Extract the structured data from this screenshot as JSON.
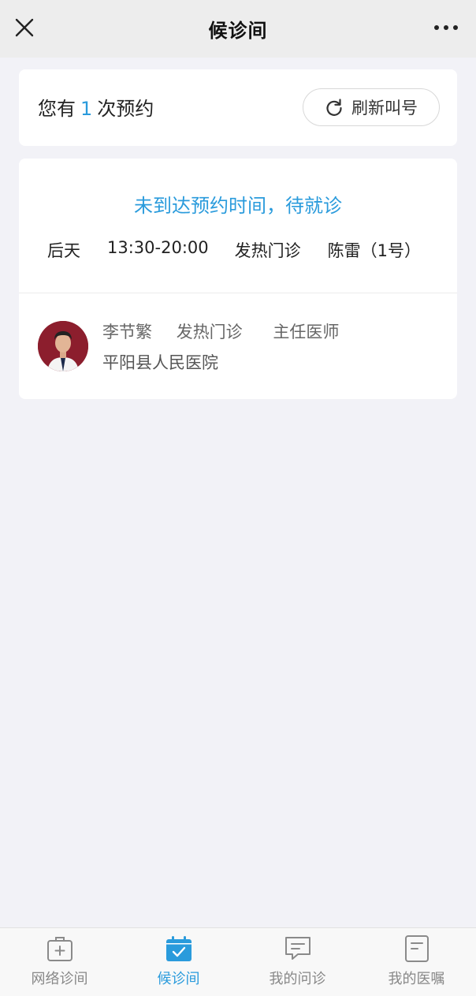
{
  "header": {
    "title": "候诊间",
    "close_icon": "close-icon",
    "more_icon": "more-icon"
  },
  "summary": {
    "prefix": "您有",
    "count": "1",
    "suffix": "次预约",
    "refresh_label": "刷新叫号",
    "refresh_icon": "refresh-icon"
  },
  "appointment": {
    "status": "未到达预约时间，待就诊",
    "day": "后天",
    "time": "13:30-20:00",
    "department": "发热门诊",
    "patient": "陈雷（1号）"
  },
  "doctor": {
    "name": "李节繁",
    "department": "发热门诊",
    "title": "主任医师",
    "hospital": "平阳县人民医院"
  },
  "tabs": [
    {
      "label": "网络诊间",
      "icon": "medical-kit-icon",
      "active": false
    },
    {
      "label": "候诊间",
      "icon": "calendar-check-icon",
      "active": true
    },
    {
      "label": "我的问诊",
      "icon": "chat-icon",
      "active": false
    },
    {
      "label": "我的医嘱",
      "icon": "document-icon",
      "active": false
    }
  ],
  "colors": {
    "accent": "#2a9bdc",
    "navbar": "#ededed",
    "background": "#f2f2f7",
    "avatar_bg": "#8c1e2d"
  }
}
